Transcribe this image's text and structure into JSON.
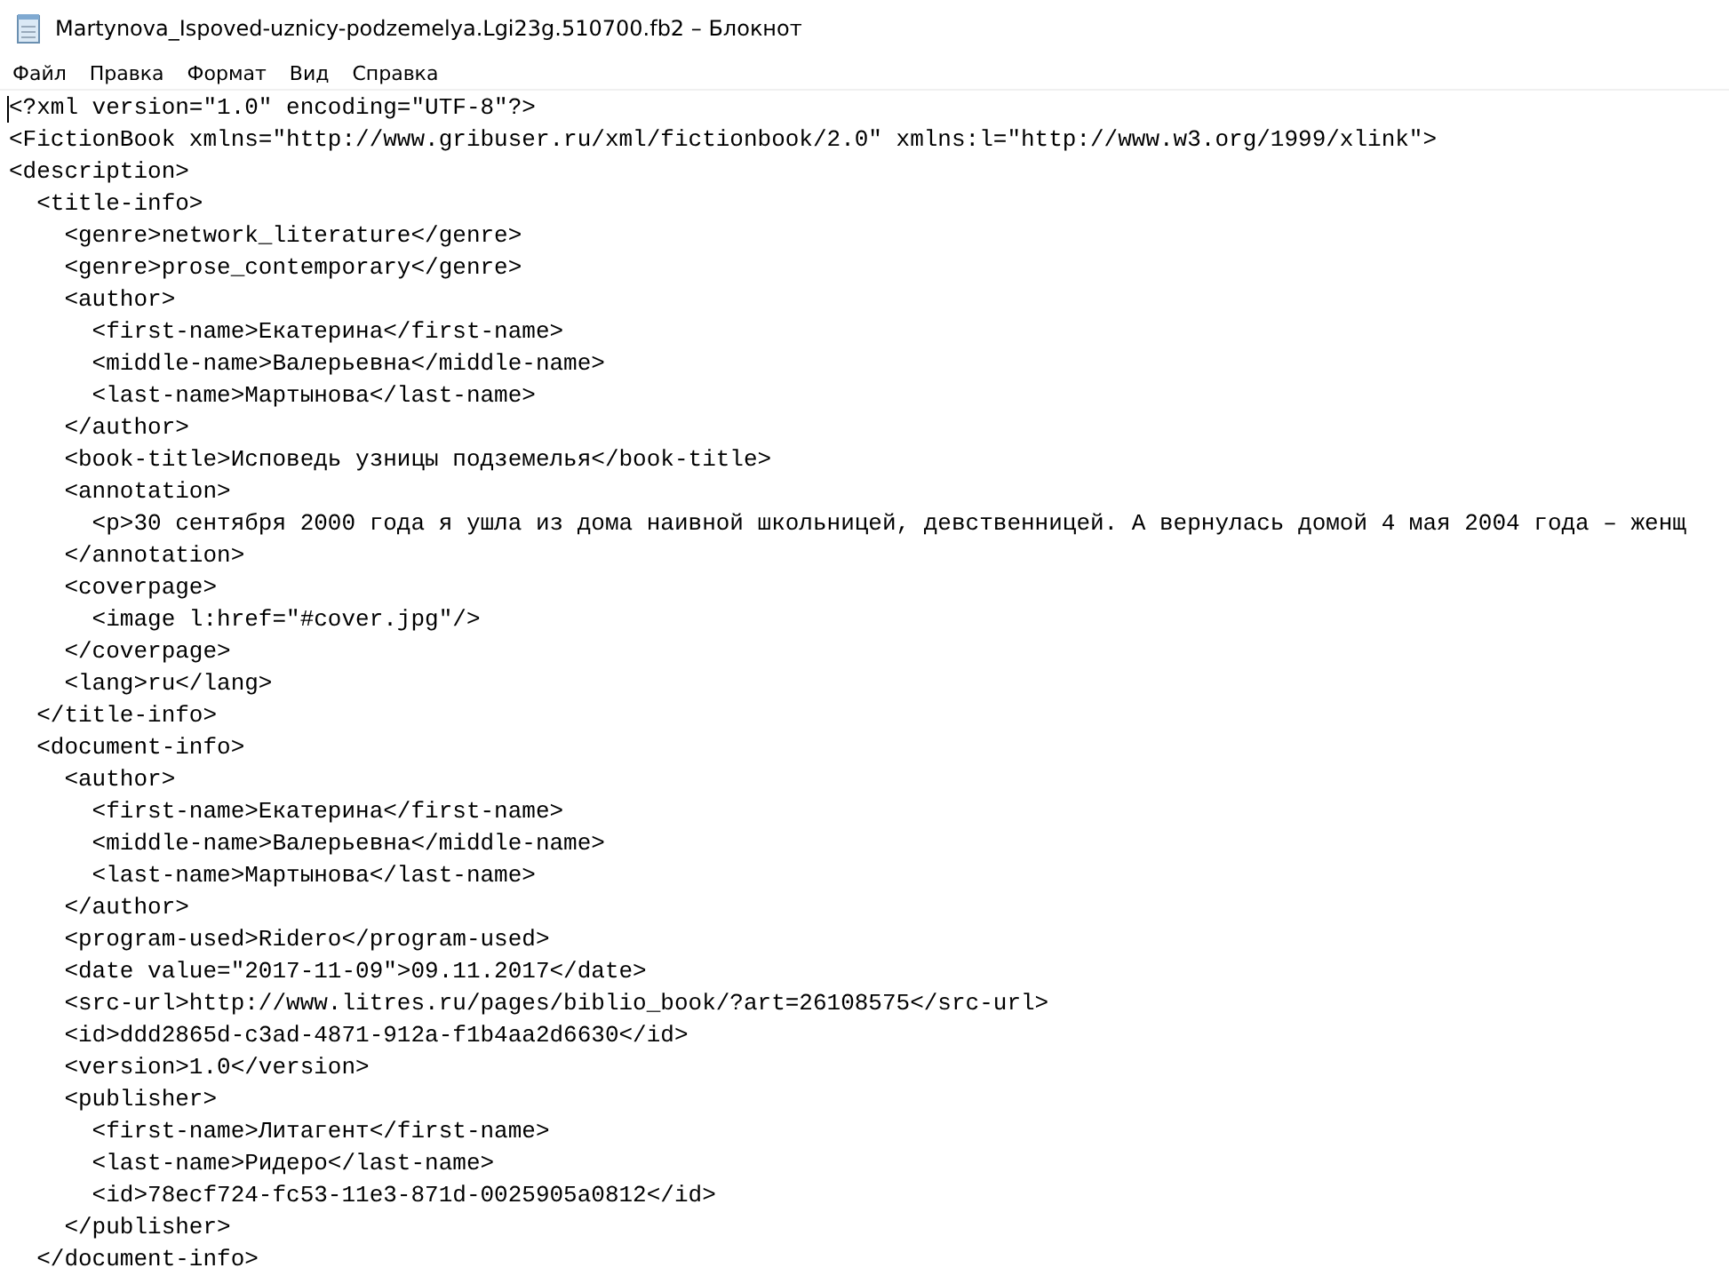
{
  "window": {
    "title": "Martynova_Ispoved-uznicy-podzemelya.Lgi23g.510700.fb2 – Блокнот"
  },
  "menu": [
    "Файл",
    "Правка",
    "Формат",
    "Вид",
    "Справка"
  ],
  "editor": {
    "lines": [
      "<?xml version=\"1.0\" encoding=\"UTF-8\"?>",
      "<FictionBook xmlns=\"http://www.gribuser.ru/xml/fictionbook/2.0\" xmlns:l=\"http://www.w3.org/1999/xlink\">",
      "<description>",
      "  <title-info>",
      "    <genre>network_literature</genre>",
      "    <genre>prose_contemporary</genre>",
      "    <author>",
      "      <first-name>Екатерина</first-name>",
      "      <middle-name>Валерьевна</middle-name>",
      "      <last-name>Мартынова</last-name>",
      "    </author>",
      "    <book-title>Исповедь узницы подземелья</book-title>",
      "    <annotation>",
      "      <p>30 сентября 2000 года я ушла из дома наивной школьницей, девственницей. А вернулась домой 4 мая 2004 года – женщ",
      "    </annotation>",
      "    <coverpage>",
      "      <image l:href=\"#cover.jpg\"/>",
      "    </coverpage>",
      "    <lang>ru</lang>",
      "  </title-info>",
      "  <document-info>",
      "    <author>",
      "      <first-name>Екатерина</first-name>",
      "      <middle-name>Валерьевна</middle-name>",
      "      <last-name>Мартынова</last-name>",
      "    </author>",
      "    <program-used>Ridero</program-used>",
      "    <date value=\"2017-11-09\">09.11.2017</date>",
      "    <src-url>http://www.litres.ru/pages/biblio_book/?art=26108575</src-url>",
      "    <id>ddd2865d-c3ad-4871-912a-f1b4aa2d6630</id>",
      "    <version>1.0</version>",
      "    <publisher>",
      "      <first-name>Литагент</first-name>",
      "      <last-name>Ридеро</last-name>",
      "      <id>78ecf724-fc53-11e3-871d-0025905a0812</id>",
      "    </publisher>",
      "  </document-info>"
    ]
  }
}
